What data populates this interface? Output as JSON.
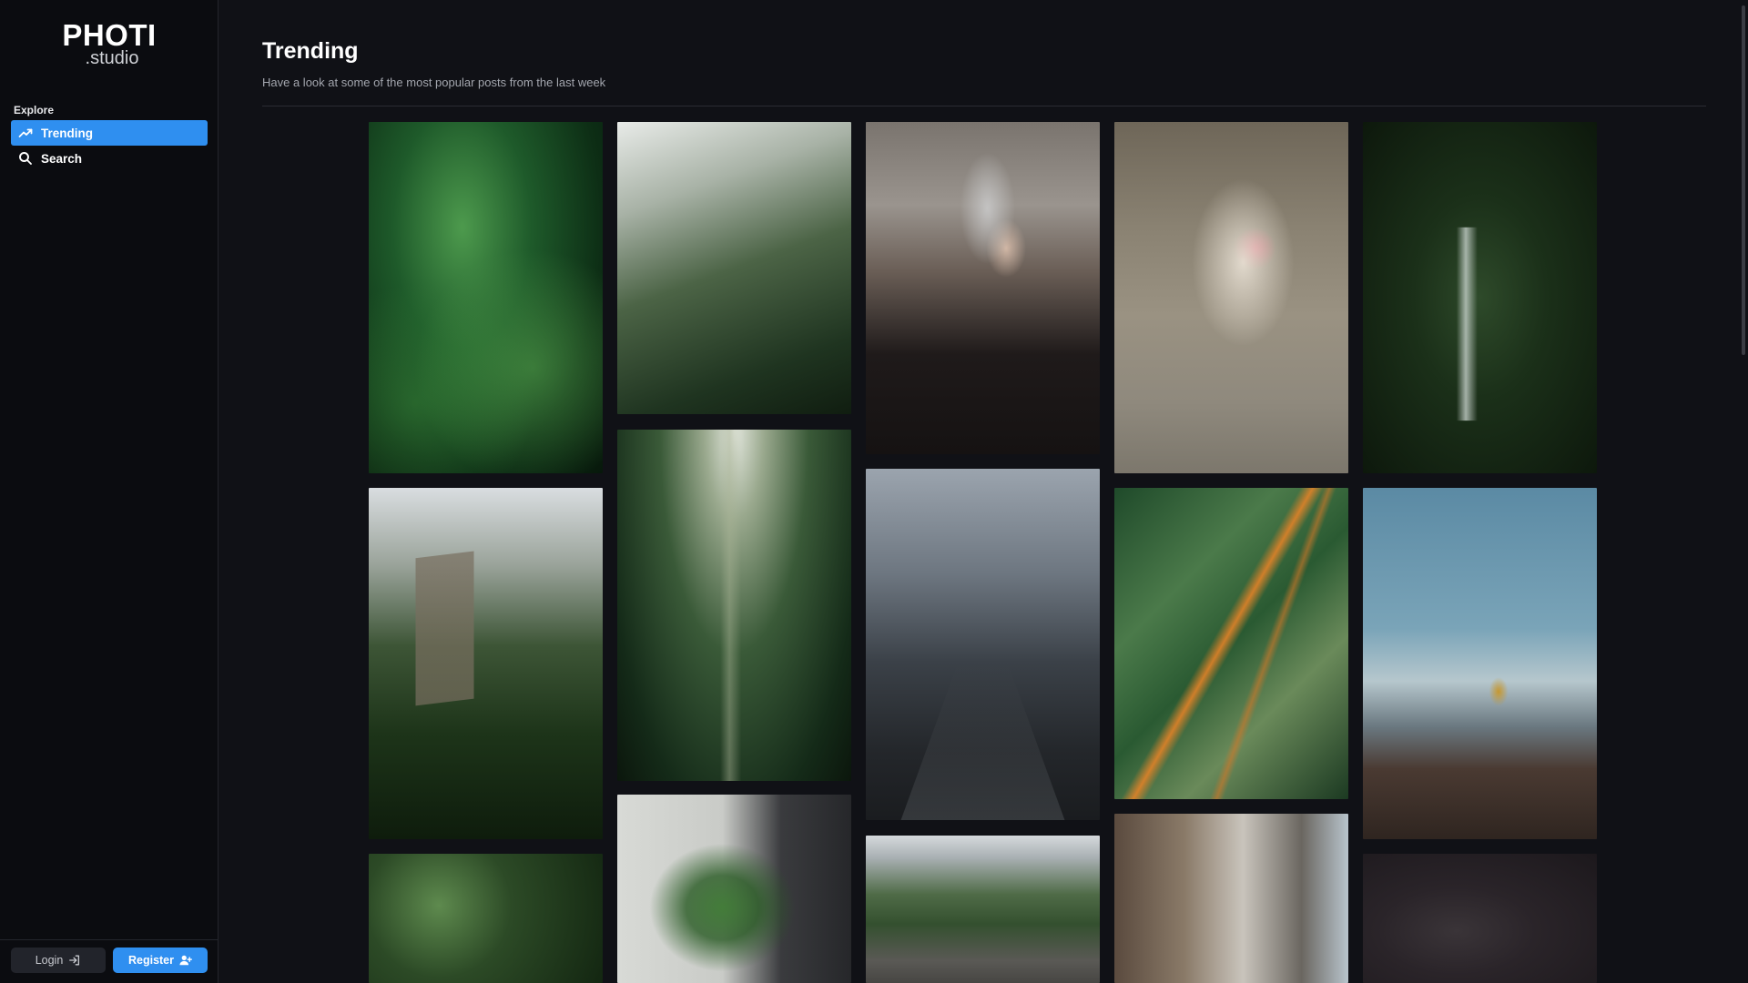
{
  "brand": {
    "name": "PHOTI",
    "suffix": ".studio"
  },
  "sidebar": {
    "section_label": "Explore",
    "items": [
      {
        "label": "Trending",
        "icon": "trending-up-icon",
        "active": true
      },
      {
        "label": "Search",
        "icon": "search-icon",
        "active": false
      }
    ]
  },
  "auth": {
    "login_label": "Login",
    "register_label": "Register"
  },
  "page": {
    "title": "Trending",
    "subtitle": "Have a look at some of the most popular posts from the last week"
  },
  "colors": {
    "accent": "#2f8ff0",
    "background": "#101116",
    "sidebar": "#0b0c10"
  },
  "photos": [
    {
      "subject": "green leaves"
    },
    {
      "subject": "fern close-up"
    },
    {
      "subject": "woman with camera and beret"
    },
    {
      "subject": "chair with tulip basket"
    },
    {
      "subject": "jungle waterfall"
    },
    {
      "subject": "building among trees"
    },
    {
      "subject": "bamboo forest"
    },
    {
      "subject": "foggy forest road"
    },
    {
      "subject": "palm leaf"
    },
    {
      "subject": "hiker on mountain"
    },
    {
      "subject": "variegated leaves"
    },
    {
      "subject": "houseplant by table"
    },
    {
      "subject": "green hills"
    },
    {
      "subject": "city street with signs"
    },
    {
      "subject": "dark cloudy sky"
    }
  ]
}
